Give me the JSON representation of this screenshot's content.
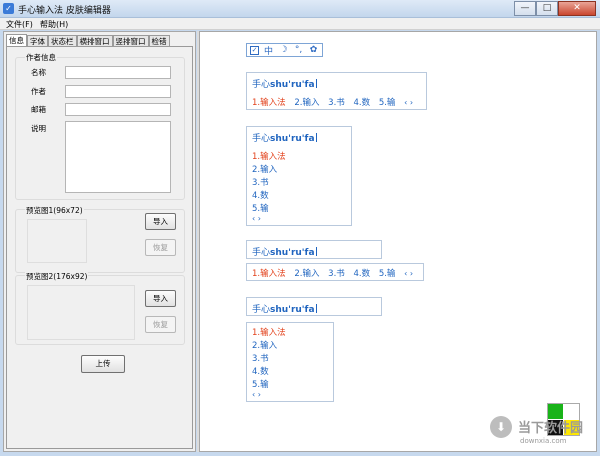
{
  "window": {
    "title": "手心输入法 皮肤编辑器",
    "minimize": "—",
    "maximize": "□",
    "close": "✕"
  },
  "menu": [
    {
      "label": "文件(F)"
    },
    {
      "label": "帮助(H)"
    }
  ],
  "tabs": [
    {
      "label": "信息",
      "active": true
    },
    {
      "label": "字体"
    },
    {
      "label": "状态栏"
    },
    {
      "label": "横排窗口"
    },
    {
      "label": "竖排窗口"
    },
    {
      "label": "检错"
    }
  ],
  "author_group": {
    "title": "作者信息",
    "name_label": "名称",
    "name_value": "",
    "author_label": "作者",
    "author_value": "",
    "email_label": "邮箱",
    "email_value": "",
    "desc_label": "说明",
    "desc_value": ""
  },
  "preview1": {
    "title": "预览图1(96x72)",
    "import_label": "导入",
    "restore_label": "恢复"
  },
  "preview2": {
    "title": "预览图2(176x92)",
    "import_label": "导入",
    "restore_label": "恢复"
  },
  "upload_label": "上传",
  "statusbar": {
    "check": "✓",
    "lang": "中",
    "moon": "☽",
    "punct": "°,",
    "gear": "✿"
  },
  "preview": {
    "pinyin_prefix": "手心",
    "pinyin_bold": "shu'ru'fa",
    "candidates": [
      "1.输入法",
      "2.输入",
      "3.书",
      "4.数",
      "5.输"
    ],
    "pager": "‹ ›"
  },
  "watermark": {
    "text": "当下软件园",
    "url": "downxia.com",
    "arrow": "⬇"
  }
}
